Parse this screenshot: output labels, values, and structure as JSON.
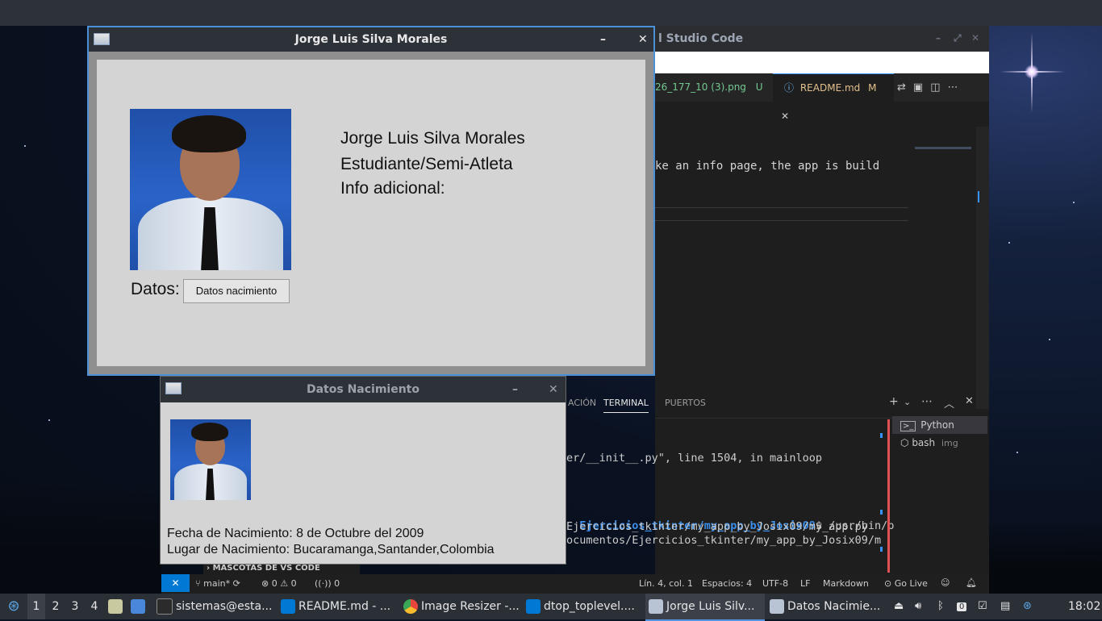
{
  "main_window": {
    "title": "Jorge Luis Silva Morales",
    "name": "Jorge Luis Silva Morales",
    "role": "Estudiante/Semi-Atleta",
    "info_label": "Info adicional:",
    "datos_label": "Datos:",
    "datos_button": "Datos nacimiento",
    "minimize": "–",
    "close": "✕"
  },
  "sub_window": {
    "title": "Datos Nacimiento",
    "birth_date": "Fecha de Nacimiento: 8 de Octubre del 2009",
    "birth_place": "Lugar de Nacimiento: Bucaramanga,Santander,Colombia",
    "minimize": "–",
    "close": "✕"
  },
  "vscode": {
    "title_fragment": "l Studio Code",
    "tab1": "26_177_10 (3).png",
    "tab1_badge": "U",
    "tab2": "README.md",
    "tab2_badge": "M",
    "editor_line": "ke an info page, the app is build",
    "panel_tabs": [
      "ACIÓN",
      "TERMINAL",
      "PUERTOS"
    ],
    "terminal_lines": [
      "er/__init__.py\", line 1504, in mainloop",
      "Ejercicios_tkinter/my_app_by_Josix09",
      "$ /usr/bin/p",
      "Ejercicios_tkinter/my_app_by_Josix09/my_app.py",
      "ocumentos/Ejercicios_tkinter/my_app_by_Josix09/m"
    ],
    "terminal_list": [
      {
        "label": "Python",
        "extra": ""
      },
      {
        "label": "bash",
        "extra": "img"
      }
    ],
    "partial_line": "MASCOTAS DE VS CODE",
    "status": {
      "branch": "main*",
      "errors": "0",
      "warnings": "0",
      "ports": "0",
      "position": "Lín. 4, col. 1",
      "spaces": "Espacios: 4",
      "encoding": "UTF-8",
      "eol": "LF",
      "language": "Markdown",
      "golive": "Go Live"
    }
  },
  "taskbar": {
    "workspaces": [
      "1",
      "2",
      "3",
      "4"
    ],
    "tasks": [
      {
        "label": "sistemas@esta...",
        "color": "#2b2b2b"
      },
      {
        "label": "README.md - ...",
        "color": "#0078d4"
      },
      {
        "label": "Image Resizer -...",
        "color": "#e8453c"
      },
      {
        "label": "dtop_toplevel....",
        "color": "#0078d4"
      },
      {
        "label": "Jorge Luis Silv...",
        "color": "#b8c4d4"
      },
      {
        "label": "Datos Nacimie...",
        "color": "#b8c4d4"
      }
    ],
    "clock": "18:02",
    "battery_badge": "0"
  },
  "colors": {
    "accent": "#4a90d9",
    "vscode_blue": "#0078d4",
    "tk_bg": "#d4d4d4",
    "taskbar_bg": "#2b2f36"
  }
}
